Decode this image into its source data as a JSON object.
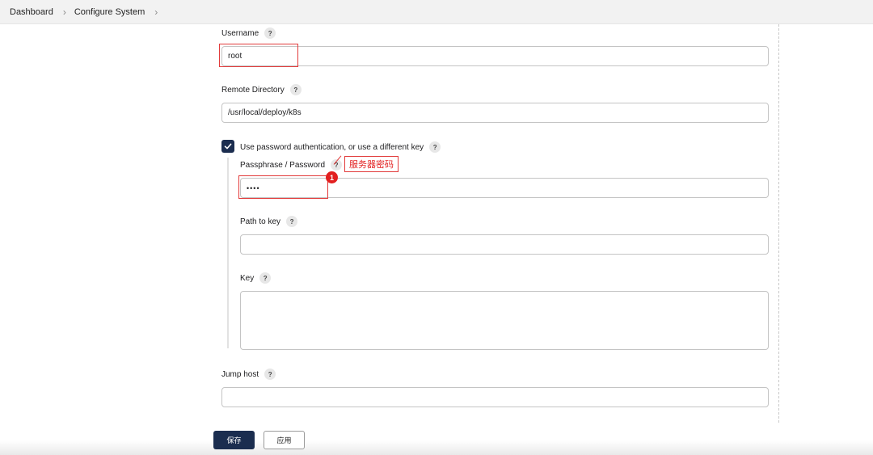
{
  "breadcrumb": {
    "items": [
      "Dashboard",
      "Configure System"
    ]
  },
  "form": {
    "username_label": "Username",
    "username_value": "root",
    "remote_dir_label": "Remote Directory",
    "remote_dir_value": "/usr/local/deploy/k8s",
    "use_password_label": "Use password authentication, or use a different key",
    "use_password_checked": true,
    "passphrase_label": "Passphrase / Password",
    "passphrase_value": "••••",
    "path_to_key_label": "Path to key",
    "path_to_key_value": "",
    "key_label": "Key",
    "key_value": "",
    "jump_host_label": "Jump host",
    "jump_host_value": "",
    "help_glyph": "?"
  },
  "annotation": {
    "number": "1",
    "text": "服务器密码",
    "color": "#e21f1f"
  },
  "actions": {
    "save_label": "保存",
    "apply_label": "应用"
  },
  "colors": {
    "primary": "#1b2d4f",
    "annotation_red": "#e23b3b"
  }
}
